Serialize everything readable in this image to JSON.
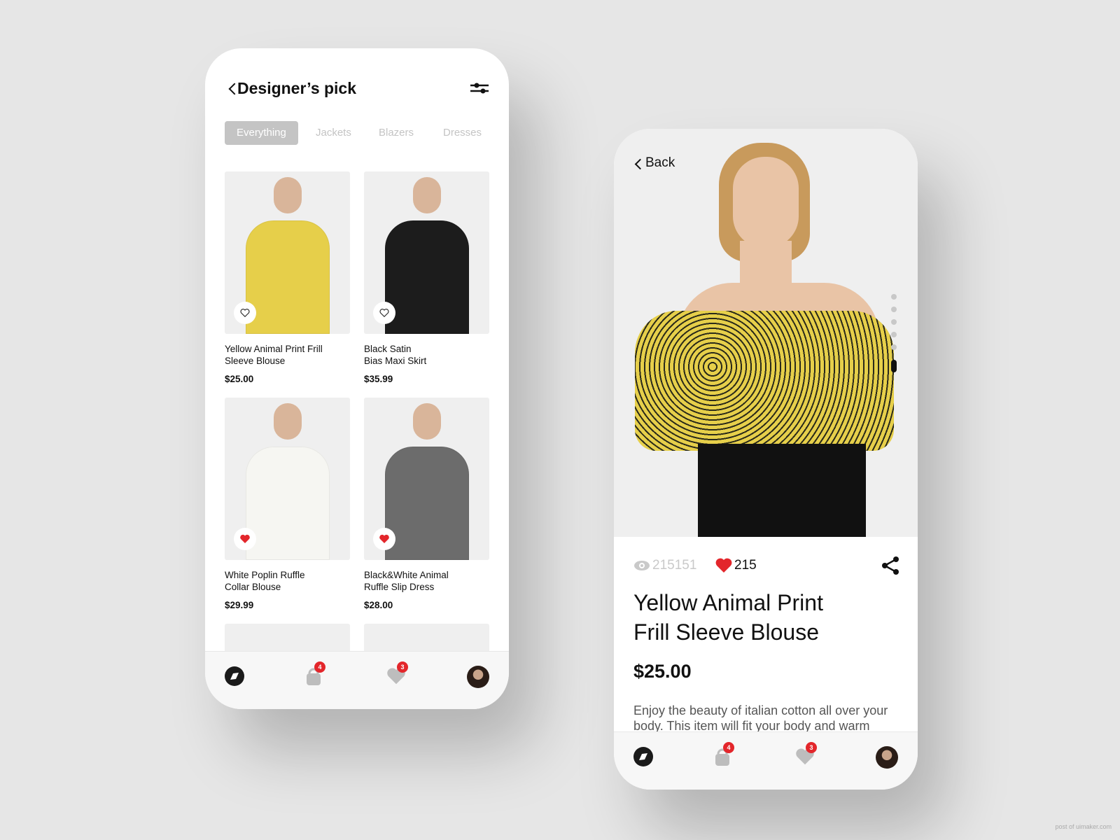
{
  "list_screen": {
    "title": "Designer’s pick",
    "tabs": [
      "Everything",
      "Jackets",
      "Blazers",
      "Dresses"
    ],
    "products": [
      {
        "name_lines": [
          "Yellow Animal Print Frill",
          "Sleeve Blouse"
        ],
        "price": "$25.00",
        "favorite": false,
        "garment_color": "#e6cf4a"
      },
      {
        "name_lines": [
          "Black Satin",
          "Bias Maxi Skirt"
        ],
        "price": "$35.99",
        "favorite": false,
        "garment_color": "#1c1c1c"
      },
      {
        "name_lines": [
          "White Poplin Ruffle",
          "Collar Blouse"
        ],
        "price": "$29.99",
        "favorite": true,
        "garment_color": "#f6f6f2"
      },
      {
        "name_lines": [
          "Black&White Animal",
          "Ruffle Slip Dress"
        ],
        "price": "$28.00",
        "favorite": true,
        "garment_color": "#6c6c6c"
      }
    ],
    "nav": {
      "cart_badge": "4",
      "favorites_badge": "3"
    }
  },
  "detail_screen": {
    "back_label": "Back",
    "views": "215151",
    "likes": "215",
    "title_lines": [
      "Yellow Animal Print",
      "Frill Sleeve Blouse"
    ],
    "price": "$25.00",
    "description_lines": [
      "Enjoy the beauty of italian cotton all over your",
      "body. This item will fit your body and warm"
    ],
    "gallery_total": 6,
    "gallery_active": 6,
    "nav": {
      "cart_badge": "4",
      "favorites_badge": "3"
    }
  },
  "colors": {
    "accent_red": "#e3262b",
    "tab_active_bg": "#c4c4c4"
  },
  "watermark": "post of uimaker.com"
}
